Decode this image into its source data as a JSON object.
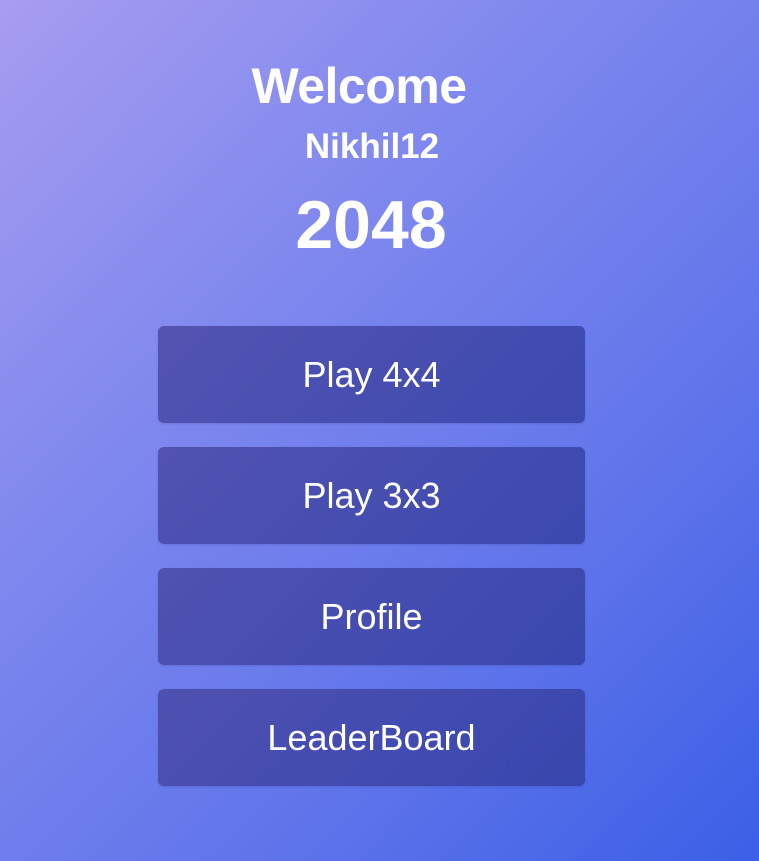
{
  "header": {
    "welcome": "Welcome",
    "username": "Nikhil12",
    "game_title": "2048"
  },
  "menu": {
    "items": [
      {
        "label": "Play 4x4"
      },
      {
        "label": "Play 3x3"
      },
      {
        "label": "Profile"
      },
      {
        "label": "LeaderBoard"
      }
    ]
  },
  "colors": {
    "background_start": "#a79cf0",
    "background_end": "#3b5fe6",
    "button": "#4a4fb0",
    "text": "#ffffff"
  }
}
